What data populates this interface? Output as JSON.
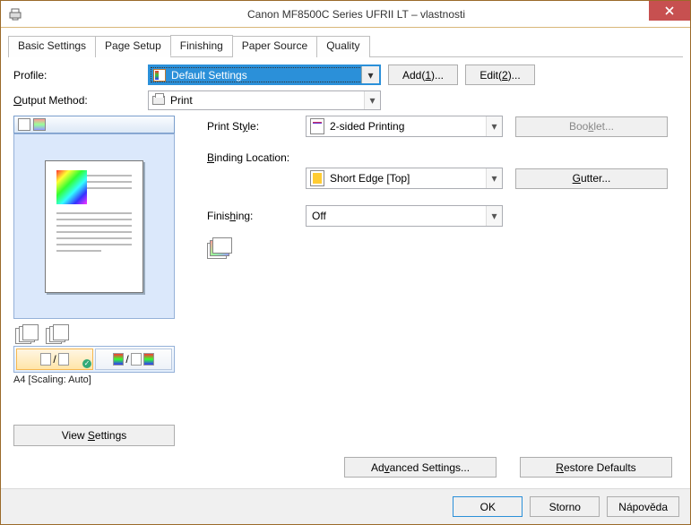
{
  "window": {
    "title": "Canon MF8500C Series UFRII LT – vlastnosti"
  },
  "tabs": {
    "items": [
      {
        "label": "Basic Settings"
      },
      {
        "label": "Page Setup"
      },
      {
        "label": "Finishing"
      },
      {
        "label": "Paper Source"
      },
      {
        "label": "Quality"
      }
    ],
    "active_index": 2
  },
  "profile": {
    "label": "Profile:",
    "value": "Default Settings",
    "add_btn": "Add(1)...",
    "edit_btn": "Edit(2)..."
  },
  "output_method": {
    "label": "Output Method:",
    "value": "Print"
  },
  "preview": {
    "caption": "A4 [Scaling: Auto]",
    "view_settings_btn": "View Settings"
  },
  "form": {
    "print_style_label": "Print Style:",
    "print_style_value": "2-sided Printing",
    "booklet_btn": "Booklet...",
    "binding_label": "Binding Location:",
    "binding_value": "Short Edge [Top]",
    "gutter_btn": "Gutter...",
    "finishing_label": "Finishing:",
    "finishing_value": "Off"
  },
  "bottom": {
    "advanced_btn": "Advanced Settings...",
    "restore_btn": "Restore Defaults"
  },
  "footer": {
    "ok": "OK",
    "cancel": "Storno",
    "help": "Nápověda"
  }
}
